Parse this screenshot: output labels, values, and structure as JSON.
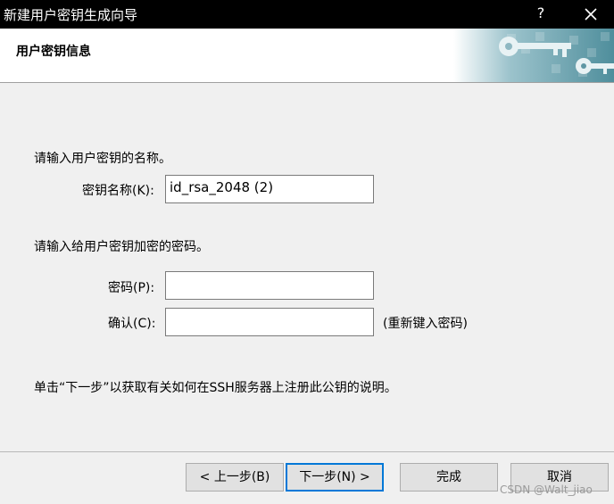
{
  "window": {
    "title": "新建用户密钥生成向导",
    "help_glyph": "?"
  },
  "header": {
    "title": "用户密钥信息"
  },
  "form": {
    "name_prompt": "请输入用户密钥的名称。",
    "key_name_label": "密钥名称(K):",
    "key_name_value": "id_rsa_2048 (2)",
    "password_prompt": "请输入给用户密钥加密的密码。",
    "password_label": "密码(P):",
    "password_value": "",
    "confirm_label": "确认(C):",
    "confirm_value": "",
    "confirm_hint": "(重新键入密码)",
    "note": "单击“下一步”以获取有关如何在SSH服务器上注册此公钥的说明。"
  },
  "buttons": {
    "back": "< 上一步(B)",
    "next": "下一步(N) >",
    "finish": "完成",
    "cancel": "取消"
  },
  "watermark": "CSDN @Walt_jiao",
  "colors": {
    "title_bar": "#000000",
    "focus_border": "#0078d7",
    "banner_teal": "#5a9aa8"
  },
  "icons": [
    "help-icon",
    "close-icon",
    "key-banner-icon"
  ]
}
